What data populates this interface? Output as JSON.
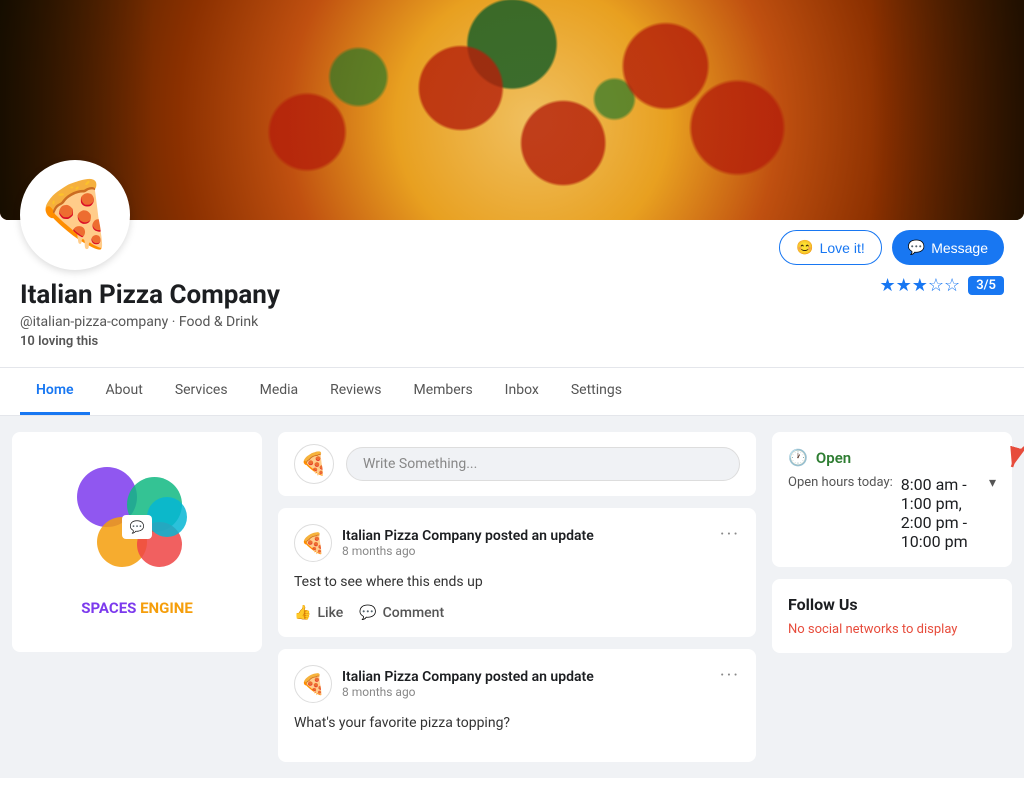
{
  "page": {
    "title": "Italian Pizza Company"
  },
  "cover": {
    "alt": "Pizza cover photo"
  },
  "profile": {
    "name": "Italian Pizza Company",
    "handle": "@italian-pizza-company",
    "category": "Food & Drink",
    "loving": "10 loving this",
    "avatar_emoji": "🍕",
    "rating_text": "3/5",
    "stars_filled": 3,
    "stars_total": 5
  },
  "buttons": {
    "love": "Love it!",
    "message": "Message"
  },
  "nav": {
    "items": [
      {
        "label": "Home",
        "active": true
      },
      {
        "label": "About",
        "active": false
      },
      {
        "label": "Services",
        "active": false
      },
      {
        "label": "Media",
        "active": false
      },
      {
        "label": "Reviews",
        "active": false
      },
      {
        "label": "Members",
        "active": false
      },
      {
        "label": "Inbox",
        "active": false
      },
      {
        "label": "Settings",
        "active": false
      }
    ]
  },
  "spaces_widget": {
    "label_spaces": "SPACES",
    "label_engine": "ENGINE"
  },
  "write_post": {
    "placeholder": "Write Something..."
  },
  "posts": [
    {
      "author": "Italian Pizza Company",
      "action": "posted an update",
      "time": "8 months ago",
      "content": "Test to see where this ends up",
      "like_label": "Like",
      "comment_label": "Comment"
    },
    {
      "author": "Italian Pizza Company",
      "action": "posted an update",
      "time": "8 months ago",
      "content": "What's your favorite pizza topping?",
      "like_label": "Like",
      "comment_label": "Comment"
    }
  ],
  "hours": {
    "status": "Open",
    "label": "Open hours today:",
    "value_line1": "8:00 am - 1:00 pm,",
    "value_line2": "2:00 pm - 10:00 pm"
  },
  "follow_us": {
    "title": "Follow Us",
    "no_social": "No social networks to display"
  }
}
